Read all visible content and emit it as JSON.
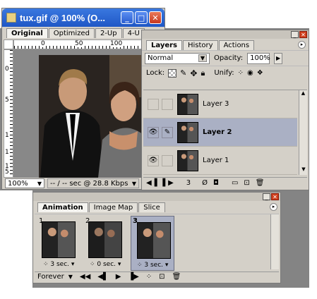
{
  "main_window": {
    "title": "tux.gif @ 100% (O...",
    "tabs": [
      "Original",
      "Optimized",
      "2-Up",
      "4-U"
    ],
    "ruler_top": [
      "0",
      "50",
      "100"
    ],
    "ruler_left": [
      "0",
      "5",
      "1",
      "1",
      "1",
      "5"
    ],
    "status_zoom": "100%",
    "status_info": "-- / -- sec @ 28.8 Kbps"
  },
  "layers_panel": {
    "tabs": [
      "Layers",
      "History",
      "Actions"
    ],
    "blend_mode": "Normal",
    "opacity_label": "Opacity:",
    "opacity_value": "100%",
    "lock_label": "Lock:",
    "unify_label": "Unify:",
    "layers": [
      {
        "name": "Layer 3",
        "visible": false,
        "selected": false
      },
      {
        "name": "Layer 2",
        "visible": true,
        "selected": true
      },
      {
        "name": "Layer 1",
        "visible": true,
        "selected": false
      }
    ],
    "frame_count": "3"
  },
  "animation_panel": {
    "tabs": [
      "Animation",
      "Image Map",
      "Slice"
    ],
    "frames": [
      {
        "number": "1",
        "delay": "3 sec."
      },
      {
        "number": "2",
        "delay": "0 sec."
      },
      {
        "number": "3",
        "delay": "3 sec."
      }
    ],
    "loop": "Forever"
  },
  "colors": {
    "xp_blue": "#1f57c6",
    "panel_bg": "#d4d0c8",
    "selected_layer": "#aab0c4"
  }
}
